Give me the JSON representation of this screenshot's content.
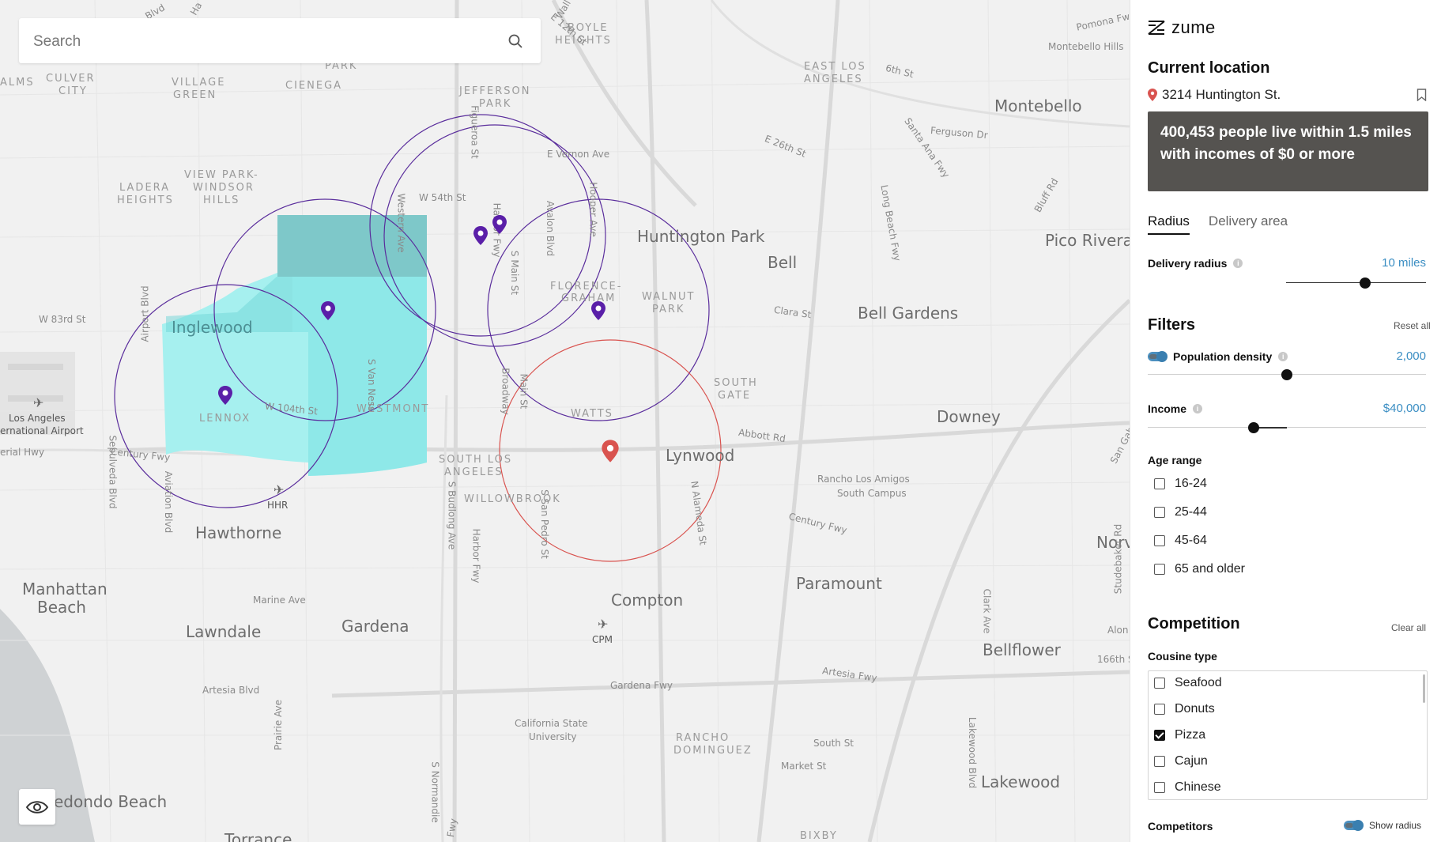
{
  "search": {
    "placeholder": "Search"
  },
  "map": {
    "labels_large": [
      "Montebello",
      "Huntington Park",
      "Bell",
      "Pico Rivera",
      "Bell Gardens",
      "Inglewood",
      "Downey",
      "Lynwood",
      "Hawthorne",
      "Compton",
      "Paramount",
      "Manhattan",
      "Beach",
      "Lawndale",
      "Gardena",
      "Bellflower",
      "Lakewood",
      "edondo Beach",
      "Torrance",
      "Norv"
    ],
    "labels_caps": [
      "BOYLE",
      "HEIGHTS",
      "EAST LOS",
      "ANGELES",
      "JEFFERSON",
      "PARK",
      "CULVER",
      "CITY",
      "VILLAGE",
      "GREEN",
      "CIENEGA",
      "LADERA",
      "HEIGHTS",
      "VIEW PARK-",
      "WINDSOR",
      "HILLS",
      "FLORENCE-",
      "GRAHAM",
      "WALNUT",
      "PARK",
      "SOUTH",
      "GATE",
      "WATTS",
      "LENNOX",
      "WESTMONT",
      "SOUTH LOS",
      "ANGELES",
      "WILLOWBROOK",
      "RANCHO",
      "DOMINGUEZ",
      "BIXBY",
      "PARK",
      "ALMS"
    ],
    "labels_small": [
      "Pomona Fwy",
      "Montebello Hills",
      "6th St",
      "Ferguson Dr",
      "E 26th St",
      "Santa Ana Fwy",
      "Bluff Rd",
      "E Vernon Ave",
      "W 54th St",
      "Figueroa St",
      "Hooper Ave",
      "Harbor Fwy",
      "Avalon Blvd",
      "S Main St",
      "Long Beach Fwy",
      "Clara St",
      "Abbott Rd",
      "Rancho Los Amigos",
      "South Campus",
      "Century Fwy",
      "W 83rd St",
      "Airport Blvd",
      "W 104th St",
      "Broadway",
      "Main St",
      "S Van Ness",
      "Western Ave",
      "Century Fwy",
      "Sepulveda Blvd",
      "Aviation Blvd",
      "S Budlong Ave",
      "Harbor Fwy",
      "S San Pedro St",
      "N Alameda St",
      "Marine Ave",
      "Artesia Blvd",
      "Prairie Ave",
      "S Normandie",
      "Gardena Fwy",
      "California State",
      "University",
      "South St",
      "Market St",
      "Artesia Fwy",
      "Clark Ave",
      "Lakewood Blvd",
      "Studebaker Rd",
      "166th St",
      "San Gabriel River Fwy",
      "Alon",
      "erial Hwy",
      "Los Angeles",
      "ernational Airport",
      "E 12th St",
      "Wall",
      "Blvd",
      "Ha",
      "Fwy"
    ],
    "airports": [
      "HHR",
      "CPM"
    ]
  },
  "panel": {
    "brand": "zume",
    "current_location_title": "Current location",
    "address": "3214 Huntington St.",
    "info": "400,453 people live within 1.5 miles with incomes of $0 or more",
    "tabs": [
      "Radius",
      "Delivery area"
    ],
    "active_tab": "Radius",
    "delivery_radius": {
      "label": "Delivery radius",
      "value": "10 miles",
      "fraction": 0.78
    },
    "filters": {
      "title": "Filters",
      "reset": "Reset all",
      "population_density": {
        "label": "Population density",
        "value": "2,000",
        "fraction": 0.5
      },
      "income": {
        "label": "Income",
        "value": "$40,000",
        "fraction": 0.36
      },
      "age_range": {
        "label": "Age range",
        "options": [
          {
            "label": "16-24",
            "checked": false
          },
          {
            "label": "25-44",
            "checked": false
          },
          {
            "label": "45-64",
            "checked": false
          },
          {
            "label": "65 and older",
            "checked": false
          }
        ]
      }
    },
    "competition": {
      "title": "Competition",
      "clear": "Clear all",
      "cuisine_label": "Cousine type",
      "cuisines": [
        {
          "label": "Seafood",
          "checked": false
        },
        {
          "label": "Donuts",
          "checked": false
        },
        {
          "label": "Pizza",
          "checked": true
        },
        {
          "label": "Cajun",
          "checked": false
        },
        {
          "label": "Chinese",
          "checked": false
        }
      ],
      "competitors_label": "Competitors",
      "show_radius": "Show radius"
    }
  },
  "colors": {
    "accent": "#3b8ec3",
    "circle_purple": "#5a2d9c",
    "circle_red": "#d9534f",
    "area_cyan": "#9ff0ef",
    "info_bg": "#555350"
  }
}
